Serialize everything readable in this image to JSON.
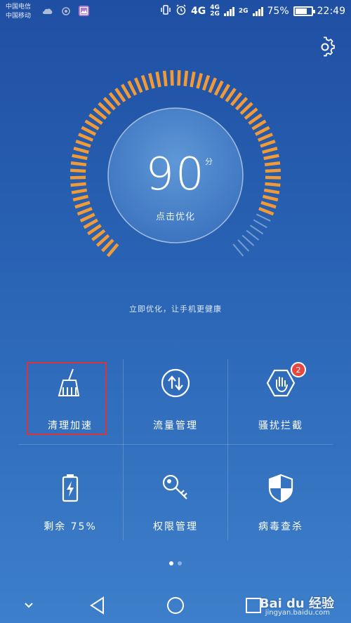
{
  "status_bar": {
    "carrier_1": "中国电信",
    "carrier_2": "中国移动",
    "network_4g": "4G",
    "network_4g_small": "4G",
    "network_2g_small": "2G",
    "network_2g": "2G",
    "battery_percent": "75%",
    "battery_level": 0.75,
    "time": "22:49"
  },
  "score": {
    "value": "90",
    "unit": "分",
    "level": 0.9,
    "action_label": "点击优化"
  },
  "subtitle": "立即优化，让手机更健康",
  "tiles": [
    {
      "label": "清理加速",
      "icon": "broom-icon"
    },
    {
      "label": "流量管理",
      "icon": "data-transfer-icon"
    },
    {
      "label": "骚扰拦截",
      "icon": "block-hand-icon",
      "badge": "2"
    },
    {
      "label": "剩余 75%",
      "icon": "battery-icon"
    },
    {
      "label": "权限管理",
      "icon": "key-icon"
    },
    {
      "label": "病毒查杀",
      "icon": "shield-icon"
    }
  ],
  "pager": {
    "pages": 2,
    "active": 1
  },
  "watermark": {
    "brand": "Bai du 经验",
    "url": "jingyan.baidu.com"
  },
  "colors": {
    "accent_orange": "#f29a36",
    "background_top": "#1f4fa3",
    "background_bottom": "#3d7fca",
    "selection_red": "#d9343a",
    "badge_red": "#e8473f"
  }
}
